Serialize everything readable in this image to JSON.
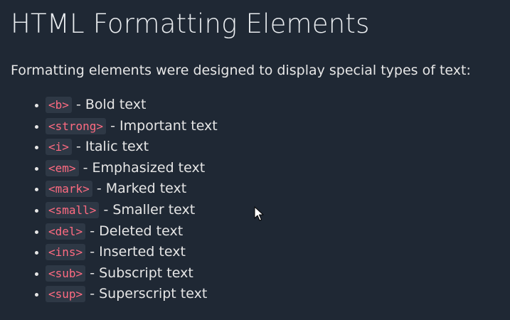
{
  "heading": "HTML Formatting Elements",
  "intro": "Formatting elements were designed to display special types of text:",
  "items": [
    {
      "tag": "<b>",
      "description": "Bold text"
    },
    {
      "tag": "<strong>",
      "description": "Important text"
    },
    {
      "tag": "<i>",
      "description": "Italic text"
    },
    {
      "tag": "<em>",
      "description": "Emphasized text"
    },
    {
      "tag": "<mark>",
      "description": "Marked text"
    },
    {
      "tag": "<small>",
      "description": "Smaller text"
    },
    {
      "tag": "<del>",
      "description": "Deleted text"
    },
    {
      "tag": "<ins>",
      "description": "Inserted text"
    },
    {
      "tag": "<sub>",
      "description": "Subscript text"
    },
    {
      "tag": "<sup>",
      "description": "Superscript text"
    }
  ],
  "separator": "-",
  "cursor_icon": "mouse-pointer-icon",
  "colors": {
    "background": "#1f2834",
    "text": "#e6e6e6",
    "code_text": "#ff6b81",
    "code_background": "#2e3845"
  }
}
